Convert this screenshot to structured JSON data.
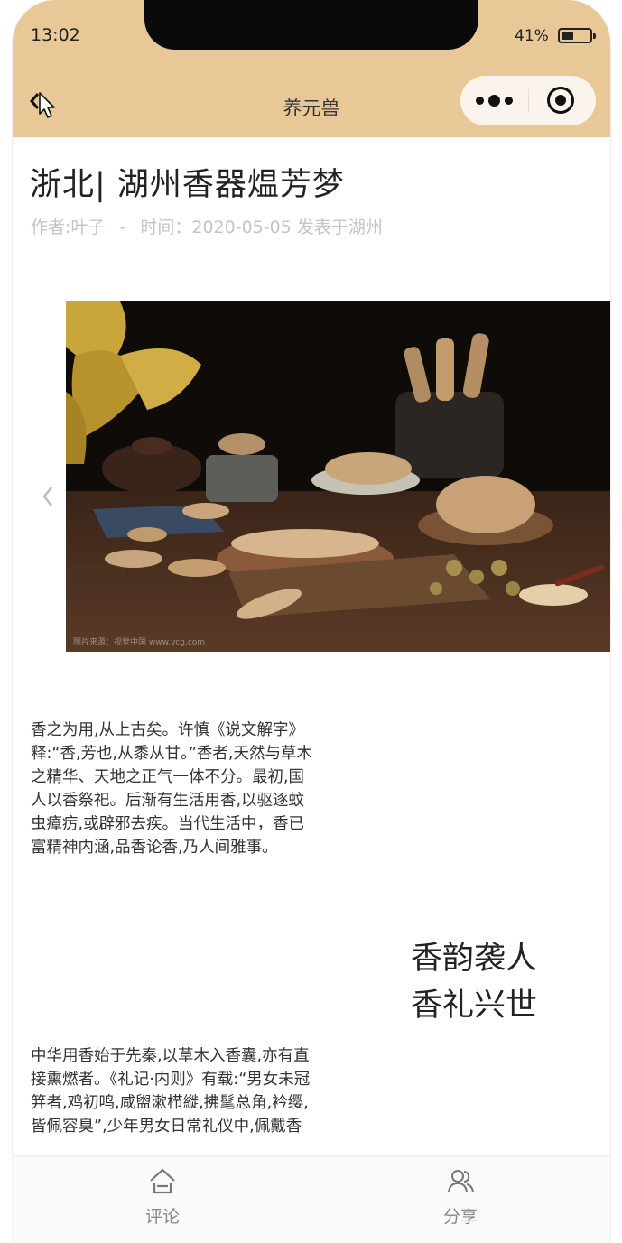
{
  "status_bar": {
    "time": "13:02",
    "battery_percent": "41%"
  },
  "nav": {
    "title": "养元兽"
  },
  "article": {
    "title": "浙北| 湖州香器煴芳梦",
    "author": "作者:叶子",
    "separator": "-",
    "date": "时间：2020-05-05 发表于湖州",
    "image_credit": "图片来源：视觉中国 www.vcg.com",
    "paragraph1": "香之为用,从上古矣。许慎《说文解字》释:“香,芳也,从黍从甘。”香者,天然与草木之精华、天地之正气一体不分。最初,国人以香祭祀。后渐有生活用香,以驱逐蚊虫瘴疠,或辟邪去疾。当代生活中，香已富精神内涵,品香论香,乃人间雅事。",
    "slogan_line1": "香韵袭人",
    "slogan_line2": "香礼兴世",
    "paragraph2": "中华用香始于先秦,以草木入香囊,亦有直接熏燃者。《礼记·内则》有载:“男女未冠笄者,鸡初鸣,咸盥漱栉縰,拂髦总角,衿缨,皆佩容臭”,少年男女日常礼仪中,佩戴香"
  },
  "tabbar": {
    "items": [
      {
        "label": "评论",
        "icon": "home-icon"
      },
      {
        "label": "分享",
        "icon": "users-icon"
      }
    ]
  },
  "colors": {
    "header_bg": "#e8c896",
    "capsule_bg": "#fbf4ec",
    "meta_text": "#c4c4c4"
  }
}
